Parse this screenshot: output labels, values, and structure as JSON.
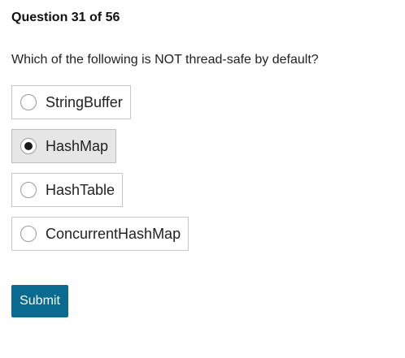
{
  "question": {
    "counter": "Question 31 of 56",
    "text": "Which of the following is NOT thread-safe by default?"
  },
  "options": [
    {
      "label": "StringBuffer",
      "selected": false
    },
    {
      "label": "HashMap",
      "selected": true
    },
    {
      "label": "HashTable",
      "selected": false
    },
    {
      "label": "ConcurrentHashMap",
      "selected": false
    }
  ],
  "submit": {
    "label": "Submit"
  },
  "colors": {
    "submit_background": "#0b6a8f",
    "selected_option_background": "#e6e6e6",
    "option_border": "#c8c8c8"
  }
}
